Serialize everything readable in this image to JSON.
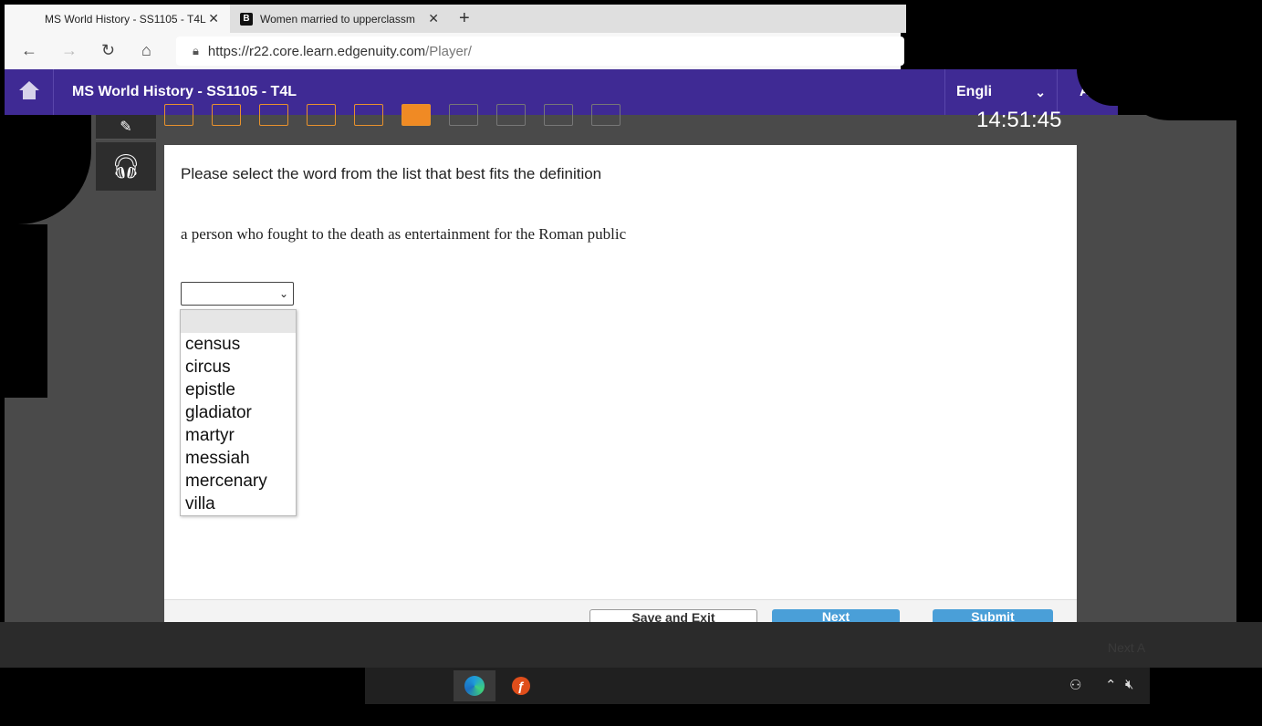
{
  "browser": {
    "active_tab_title": "MS World History - SS1105 - T4L",
    "inactive_tab_title": "Women married to upperclassm",
    "inactive_tab_favicon": "B",
    "url_host": "https://r22.core.learn.edgenuity.com",
    "url_path": "/Player/"
  },
  "header": {
    "course_title": "MS World History - SS1105 - T4L",
    "language": "Engli",
    "a_label": "A"
  },
  "stage": {
    "timer": "14:51:45"
  },
  "question": {
    "instruction": "Please select the word from the list that best fits the definition",
    "definition": "a person who fought to the death as entertainment for the Roman public",
    "options": [
      "",
      "census",
      "circus",
      "epistle",
      "gladiator",
      "martyr",
      "messiah",
      "mercenary",
      "villa"
    ]
  },
  "footer": {
    "save_label": "Save and Exit",
    "next_label": "Next",
    "submit_label": "Submit",
    "next_ghost": "Next A"
  },
  "colors": {
    "header_purple": "#3f2a94",
    "activity_orange": "#f08a24",
    "button_blue": "#4a9fd8"
  }
}
